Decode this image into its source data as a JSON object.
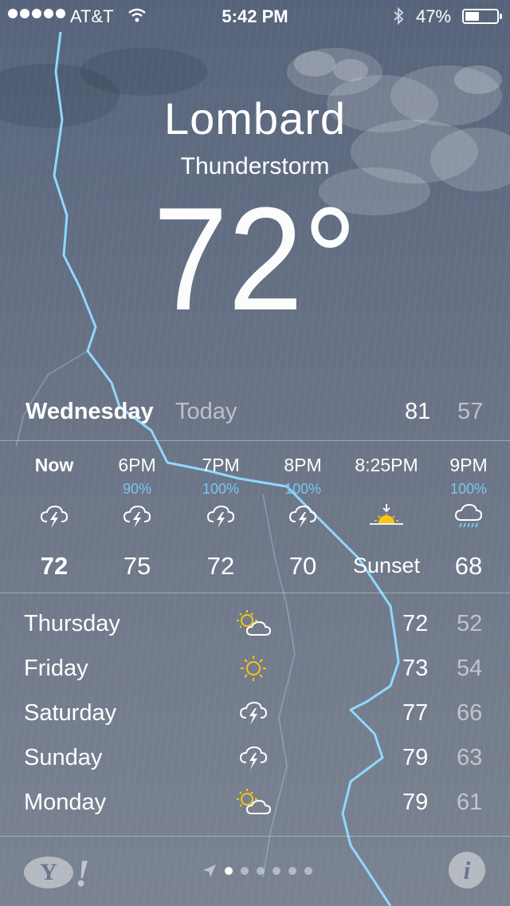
{
  "status_bar": {
    "carrier": "AT&T",
    "time": "5:42 PM",
    "battery_percent": "47%",
    "battery_level": 0.47,
    "signal_bars": 5
  },
  "location": {
    "city": "Lombard",
    "condition": "Thunderstorm",
    "temperature": "72°"
  },
  "today": {
    "day": "Wednesday",
    "label": "Today",
    "high": "81",
    "low": "57"
  },
  "hourly": [
    {
      "time": "Now",
      "prob": "",
      "icon": "thunderstorm-icon",
      "temp": "72"
    },
    {
      "time": "6PM",
      "prob": "90%",
      "icon": "thunderstorm-icon",
      "temp": "75"
    },
    {
      "time": "7PM",
      "prob": "100%",
      "icon": "thunderstorm-icon",
      "temp": "72"
    },
    {
      "time": "8PM",
      "prob": "100%",
      "icon": "thunderstorm-icon",
      "temp": "70"
    },
    {
      "time": "8:25PM",
      "prob": "",
      "icon": "sunset-icon",
      "temp": "Sunset"
    },
    {
      "time": "9PM",
      "prob": "100%",
      "icon": "rain-icon",
      "temp": "68"
    }
  ],
  "daily": [
    {
      "day": "Thursday",
      "icon": "partly-sunny-icon",
      "high": "72",
      "low": "52"
    },
    {
      "day": "Friday",
      "icon": "sunny-icon",
      "high": "73",
      "low": "54"
    },
    {
      "day": "Saturday",
      "icon": "thunderstorm-icon",
      "high": "77",
      "low": "66"
    },
    {
      "day": "Sunday",
      "icon": "thunderstorm-icon",
      "high": "79",
      "low": "63"
    },
    {
      "day": "Monday",
      "icon": "partly-sunny-icon",
      "high": "79",
      "low": "61"
    }
  ],
  "footer": {
    "yahoo_logo": "Y!",
    "info": "i",
    "page_count": 6,
    "active_page": 0
  },
  "colors": {
    "precip": "#79c6f2",
    "sun": "#f5c518",
    "bolt": "#8fd8ff"
  }
}
